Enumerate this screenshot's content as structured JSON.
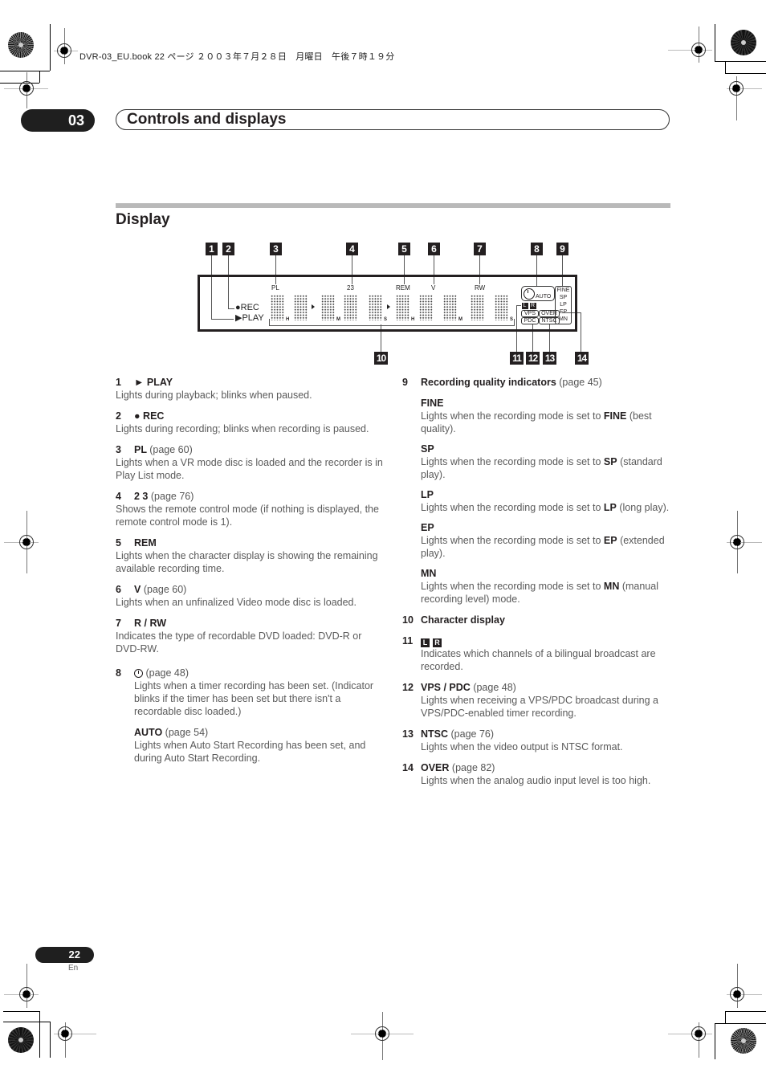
{
  "print_header": "DVR-03_EU.book  22 ページ  ２００３年７月２８日　月曜日　午後７時１９分",
  "chapter": {
    "number": "03",
    "title": "Controls and displays"
  },
  "section": {
    "title": "Display"
  },
  "figure": {
    "callouts": [
      "1",
      "2",
      "3",
      "4",
      "5",
      "6",
      "7",
      "8",
      "9",
      "10",
      "11",
      "12",
      "13",
      "14"
    ],
    "lcd_labels": {
      "rec": "●REC",
      "play": "▶PLAY",
      "pl": "PL",
      "remote": "23",
      "rem": "REM",
      "v": "V",
      "rw": "RW",
      "auto": "AUTO",
      "l": "L",
      "r": "R",
      "vps": "VPS",
      "pdc": "PDC",
      "over": "OVER",
      "ntsc": "NTSC",
      "fine": "FINE",
      "sp": "SP",
      "lp": "LP",
      "ep": "EP",
      "mn": "MN",
      "unit_h": "H",
      "unit_m": "M",
      "unit_s": "S"
    }
  },
  "left_items": [
    {
      "num": "1",
      "symbol": "►",
      "label": "PLAY",
      "page": "",
      "desc": "Lights during playback; blinks when paused."
    },
    {
      "num": "2",
      "symbol": "●",
      "label": "REC",
      "page": "",
      "desc": "Lights during recording; blinks when recording is paused."
    },
    {
      "num": "3",
      "symbol": "",
      "label": "PL",
      "page": "(page 60)",
      "desc": "Lights when a VR mode disc is loaded and the recorder is in Play List mode."
    },
    {
      "num": "4",
      "symbol": "",
      "label": "2 3",
      "page": "(page 76)",
      "desc": "Shows the remote control mode (if nothing is displayed, the remote control mode is 1)."
    },
    {
      "num": "5",
      "symbol": "",
      "label": "REM",
      "page": "",
      "desc": "Lights when the character display is showing the remaining available recording time."
    },
    {
      "num": "6",
      "symbol": "",
      "label": "V",
      "page": "(page 60)",
      "desc": "Lights when an unfinalized Video mode disc is loaded."
    },
    {
      "num": "7",
      "symbol": "",
      "label": "R / RW",
      "page": "",
      "desc": "Indicates the type of recordable DVD loaded: DVD-R or DVD-RW."
    }
  ],
  "item8": {
    "num": "8",
    "icon": "timer-icon",
    "page": "(page 48)",
    "desc": "Lights when a timer recording has been set. (Indicator blinks if the timer has been set but there isn't a recordable disc loaded.)",
    "auto": {
      "label": "AUTO",
      "page": "(page 54)",
      "desc": "Lights when Auto Start Recording has been set, and during Auto Start Recording."
    }
  },
  "item9": {
    "num": "9",
    "label": "Recording quality indicators",
    "page": "(page 45)",
    "modes": [
      {
        "label": "FINE",
        "desc_pre": "Lights when the recording mode is set to ",
        "key": "FINE",
        "desc_post": " (best quality)."
      },
      {
        "label": "SP",
        "desc_pre": "Lights when the recording mode is set to ",
        "key": "SP",
        "desc_post": " (standard play)."
      },
      {
        "label": "LP",
        "desc_pre": "Lights when the recording mode is set to ",
        "key": "LP",
        "desc_post": " (long play)."
      },
      {
        "label": "EP",
        "desc_pre": "Lights when the recording mode is set to ",
        "key": "EP",
        "desc_post": " (extended play)."
      },
      {
        "label": "MN",
        "desc_pre": "Lights when the recording mode is set to ",
        "key": "MN",
        "desc_post": " (manual recording level) mode."
      }
    ]
  },
  "item10": {
    "num": "10",
    "label": "Character display"
  },
  "item11": {
    "num": "11",
    "l": "L",
    "r": "R",
    "desc": "Indicates which channels of a bilingual broadcast are recorded."
  },
  "right_items": [
    {
      "num": "12",
      "label": "VPS / PDC",
      "page": "(page 48)",
      "desc": "Lights when receiving a VPS/PDC broadcast during a VPS/PDC-enabled timer recording."
    },
    {
      "num": "13",
      "label": "NTSC",
      "page": "(page 76)",
      "desc": "Lights when the video output is NTSC format."
    },
    {
      "num": "14",
      "label": "OVER",
      "page": "(page 82)",
      "desc": "Lights when the analog audio input level is too high."
    }
  ],
  "footer": {
    "page_number": "22",
    "language": "En"
  }
}
